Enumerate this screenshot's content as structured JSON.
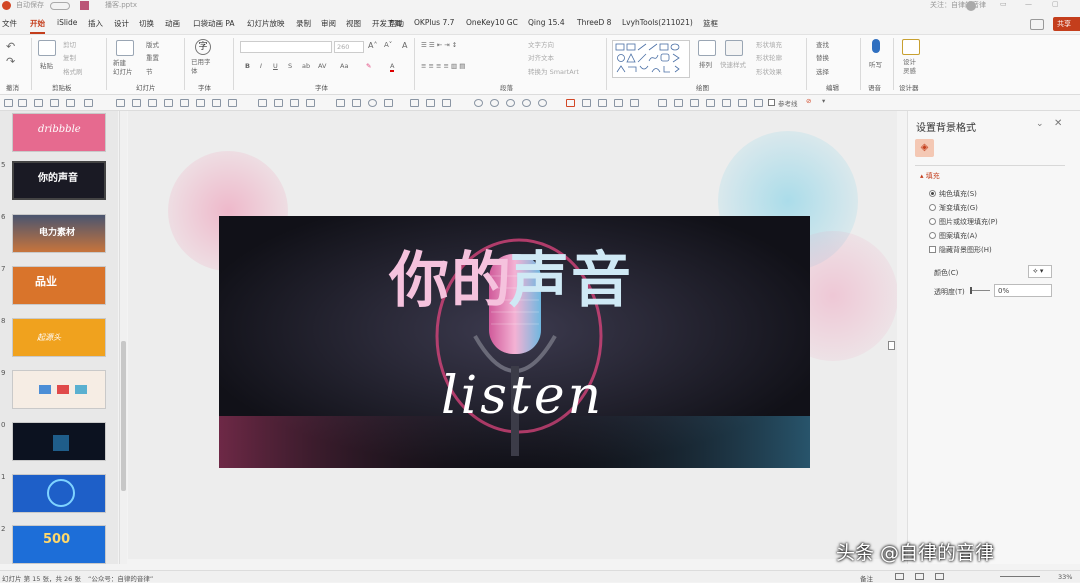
{
  "window": {
    "autosave": "自动保存",
    "filename": "播客.pptx",
    "user": "关注：自律的音律",
    "share": "共享"
  },
  "menu": {
    "items": [
      "文件",
      "开始",
      "iSlide",
      "插入",
      "设计",
      "切换",
      "动画",
      "口袋动画 PA",
      "幻灯片放映",
      "录制",
      "审阅",
      "视图",
      "开发工具",
      "帮助",
      "OKPlus 7.7",
      "OneKey10 GC",
      "Qing 15.4",
      "ThreeD 8",
      "LvyhTools(211021)",
      "篮框"
    ],
    "active": 1
  },
  "ribbon": {
    "groups": [
      "撤消",
      "剪贴板",
      "幻灯片",
      "字体",
      "段落",
      "绘图",
      "编辑",
      "语音",
      "设计器"
    ],
    "undo": "撤消",
    "paste": "粘贴",
    "cut": "剪切",
    "copy": "复制",
    "format_painter": "格式刷",
    "new_slide": "新建\n幻灯片",
    "layout": "版式",
    "reset": "重置",
    "section": "节",
    "used_font": "已用字\n体",
    "font_size": "260",
    "text_direction": "文字方向",
    "align_text": "对齐文本",
    "smartart": "转换为 SmartArt",
    "arrange": "排列",
    "quick_styles": "快速样式",
    "shape_fill": "形状填充",
    "shape_outline": "形状轮廓",
    "shape_effects": "形状效果",
    "find": "查找",
    "replace": "替换",
    "select": "选择",
    "dictate": "听写",
    "designer": "设计\n灵感",
    "reference_line": "参考线"
  },
  "slides": {
    "numbers": [
      "",
      "5",
      "6",
      "7",
      "8",
      "9",
      "0",
      "1",
      "2"
    ],
    "labels": [
      "dribbble",
      "你的声音",
      "电力素材",
      "品业",
      "起源头",
      "",
      "",
      "",
      "500"
    ]
  },
  "slide": {
    "title_left": "你的",
    "title_right": "声音",
    "script": "listen"
  },
  "panel": {
    "title": "设置背景格式",
    "section": "填充",
    "options": [
      "纯色填充(S)",
      "渐变填充(G)",
      "图片或纹理填充(P)",
      "图案填充(A)"
    ],
    "selected": 0,
    "hide_bg": "隐藏背景图形(H)",
    "color_label": "颜色(C)",
    "transparency_label": "透明度(T)",
    "transparency_value": "0%"
  },
  "status": {
    "slide_info": "幻灯片 第 15 张，共 26 张",
    "notes": "“公众号：自律的音律”",
    "notes_btn": "备注",
    "zoom": "33%"
  },
  "watermark": "头条 @自律的音律"
}
